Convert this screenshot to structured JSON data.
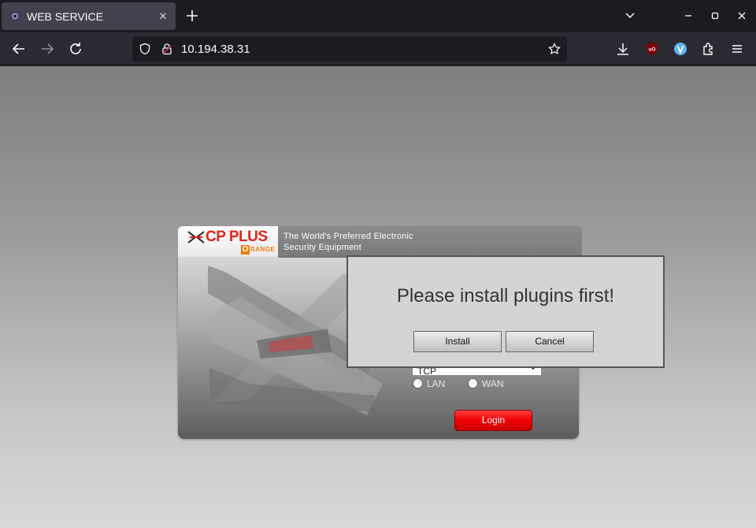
{
  "browser": {
    "tab_title": "WEB SERVICE",
    "tab_close_glyph": "✕",
    "url": "10.194.38.31",
    "icons": [
      "back-icon",
      "forward-icon",
      "reload-icon",
      "shield-icon",
      "lock-icon",
      "bookmark-star-icon",
      "download-icon",
      "ublock-icon",
      "extension-v-icon",
      "puzzle-icon",
      "menu-icon",
      "new-tab-icon",
      "tab-list-icon",
      "minimize-icon",
      "maximize-icon",
      "close-icon"
    ]
  },
  "page": {
    "logo": {
      "brand": "CP PLUS",
      "sub_initial": "O",
      "sub_rest": "RANGE"
    },
    "tagline_line1": "The World's Preferred Electronic",
    "tagline_line2": "Security Equipment",
    "protocol_value": "TCP",
    "network_options": [
      "LAN",
      "WAN"
    ],
    "login_label": "Login"
  },
  "dialog": {
    "message": "Please install plugins first!",
    "install_label": "Install",
    "cancel_label": "Cancel"
  },
  "colors": {
    "brand_red": "#e3231b",
    "brand_orange": "#f27b10",
    "login_red": "#f00000",
    "chrome_dark": "#1c1b22",
    "chrome_mid": "#2b2a33"
  }
}
